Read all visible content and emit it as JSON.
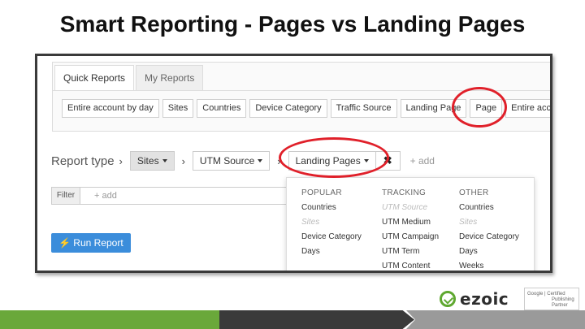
{
  "slide": {
    "title": "Smart Reporting - Pages vs Landing Pages"
  },
  "tabs": [
    {
      "label": "Quick Reports",
      "active": true
    },
    {
      "label": "My Reports",
      "active": false
    }
  ],
  "quick_reports": [
    "Entire account by day",
    "Sites",
    "Countries",
    "Device Category",
    "Traffic Source",
    "Landing Page",
    "Page",
    "Entire acco"
  ],
  "report": {
    "label": "Report type",
    "sep": "›",
    "dropdowns": [
      "Sites",
      "UTM Source",
      "Landing Pages"
    ],
    "remove": "✖",
    "add": "+ add"
  },
  "filter": {
    "label": "Filter",
    "placeholder": "+ add"
  },
  "run_button": {
    "icon": "lightning-icon",
    "glyph": "⚡",
    "label": "Run Report"
  },
  "menu": {
    "popular": {
      "header": "POPULAR",
      "items": [
        "Countries",
        "Sites",
        "Device Category",
        "Days"
      ]
    },
    "tracking": {
      "header": "TRACKING",
      "items": [
        "UTM Source",
        "UTM Medium",
        "UTM Campaign",
        "UTM Term",
        "UTM Content"
      ]
    },
    "other": {
      "header": "OTHER",
      "items": [
        "Countries",
        "Sites",
        "Device Category",
        "Days",
        "Weeks"
      ]
    }
  },
  "branding": {
    "logo_text": "ezoic",
    "badge_lines": [
      "Google | Certified",
      "Publishing",
      "Partner"
    ]
  },
  "colors": {
    "highlight": "#e0202a",
    "accent": "#3b8ddb",
    "brand_green": "#6aa83a"
  }
}
